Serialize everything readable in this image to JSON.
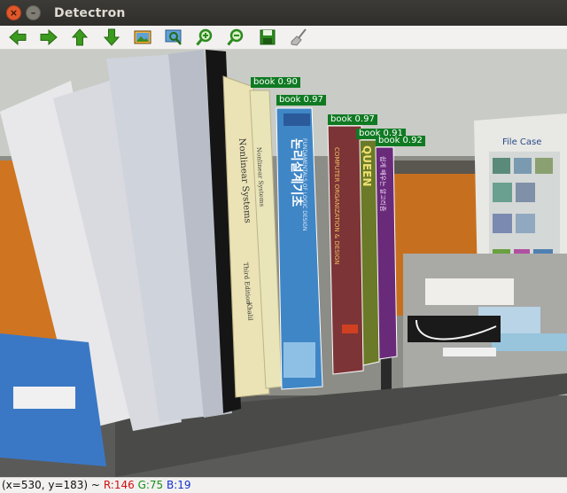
{
  "window": {
    "title": "Detectron",
    "close_glyph": "×",
    "minimize_glyph": "–"
  },
  "toolbar": {
    "buttons": [
      {
        "name": "pan-left-button",
        "icon": "arrow-left-icon",
        "color": "#3c9a1e"
      },
      {
        "name": "pan-right-button",
        "icon": "arrow-right-icon",
        "color": "#3c9a1e"
      },
      {
        "name": "pan-up-button",
        "icon": "arrow-up-icon",
        "color": "#3c9a1e"
      },
      {
        "name": "pan-down-button",
        "icon": "arrow-down-icon",
        "color": "#3c9a1e"
      },
      {
        "name": "reset-view-button",
        "icon": "image-icon",
        "color": "#2c8a1e"
      },
      {
        "name": "zoom-rect-button",
        "icon": "zoom-rect-icon",
        "color": "#2c8a1e"
      },
      {
        "name": "zoom-in-button",
        "icon": "zoom-in-icon",
        "color": "#2c8a1e"
      },
      {
        "name": "zoom-out-button",
        "icon": "zoom-out-icon",
        "color": "#2c8a1e"
      },
      {
        "name": "save-button",
        "icon": "save-icon",
        "color": "#2c8a1e"
      },
      {
        "name": "properties-button",
        "icon": "broom-icon",
        "color": "#8a8a8a"
      }
    ]
  },
  "detections": [
    {
      "label": "book 0.90",
      "class": "book",
      "score": 0.9,
      "color": "#0f7a22"
    },
    {
      "label": "book 0.97",
      "class": "book",
      "score": 0.97,
      "color": "#0f7a22"
    },
    {
      "label": "book 0.97",
      "class": "book",
      "score": 0.97,
      "color": "#0f7a22"
    },
    {
      "label": "book 0.91",
      "class": "book",
      "score": 0.91,
      "color": "#0f7a22"
    },
    {
      "label": "book 0.92",
      "class": "book",
      "score": 0.92,
      "color": "#0f7a22"
    }
  ],
  "scene_text": {
    "file_case": "File Case",
    "book_a": "Nonlinear Systems",
    "book_a_ed": "Third Edition",
    "book_a_author": "Khalil",
    "book_b": "Nonlinear Systems",
    "book_c": "논리설계기초",
    "book_c_sub": "FUNDAMENTALS OF LOGIC DESIGN",
    "book_d": "COMPUTER ORGANIZATION & DESIGN",
    "book_e": "QUEEN",
    "book_f": "쉽게 배우는 알고리즘"
  },
  "status": {
    "coords": "(x=530, y=183) ~",
    "r": "R:146",
    "g": "G:75",
    "b": "B:19"
  }
}
